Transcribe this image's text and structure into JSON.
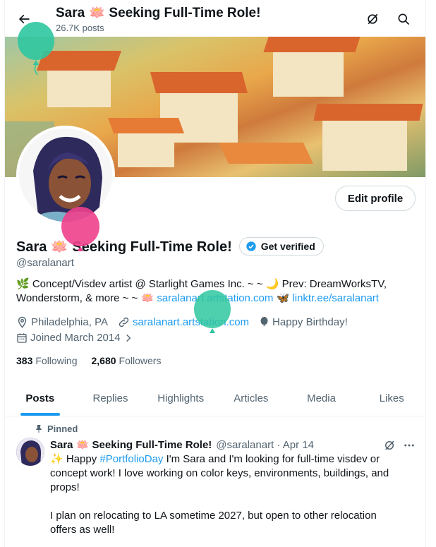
{
  "header": {
    "title": "Sara 🪷 Seeking Full-Time Role!",
    "post_count": "26.7K posts"
  },
  "profile": {
    "edit_label": "Edit profile",
    "display_name": "Sara 🪷 Seeking Full-Time Role!",
    "verify_label": "Get verified",
    "handle": "@saralanart",
    "bio_line1": "🌿 Concept/Visdev artist @ Starlight Games Inc. ~ ~ 🌙 Prev: DreamWorksTV,",
    "bio_line2_prefix": "Wonderstorm, & more ~ ~ 🪷 ",
    "bio_link1": "saralanart.artstation.com",
    "bio_mid": " 🦋 ",
    "bio_link2": "linktr.ee/saralanart",
    "location": "Philadelphia, PA",
    "website": "saralanart.artstation.com",
    "birthday": "Happy Birthday!",
    "joined": "Joined March 2014",
    "following_count": "383",
    "following_label": "Following",
    "followers_count": "2,680",
    "followers_label": "Followers"
  },
  "tabs": [
    "Posts",
    "Replies",
    "Highlights",
    "Articles",
    "Media",
    "Likes"
  ],
  "active_tab": "Posts",
  "post": {
    "pinned_label": "Pinned",
    "author_name": "Sara 🪷 Seeking Full-Time Role!",
    "author_meta": "@saralanart · Apr 14",
    "text_p1": "✨ Happy #PortfolioDay I'm Sara and I'm looking for full-time visdev or concept work! I love working on color keys, environments, buildings, and props!",
    "hashtag": "#PortfolioDay",
    "text_p2": "I plan on relocating to LA sometime 2027, but open to other relocation offers as well!"
  },
  "colors": {
    "accent": "#1d9bf0",
    "balloon_green": "#2fc7a0",
    "balloon_pink": "#f0408c"
  },
  "icons": [
    "back-arrow-icon",
    "grok-icon",
    "search-icon",
    "verified-badge-icon",
    "location-icon",
    "link-icon",
    "balloon-icon",
    "calendar-icon",
    "chevron-right-icon",
    "pin-icon",
    "more-icon"
  ]
}
